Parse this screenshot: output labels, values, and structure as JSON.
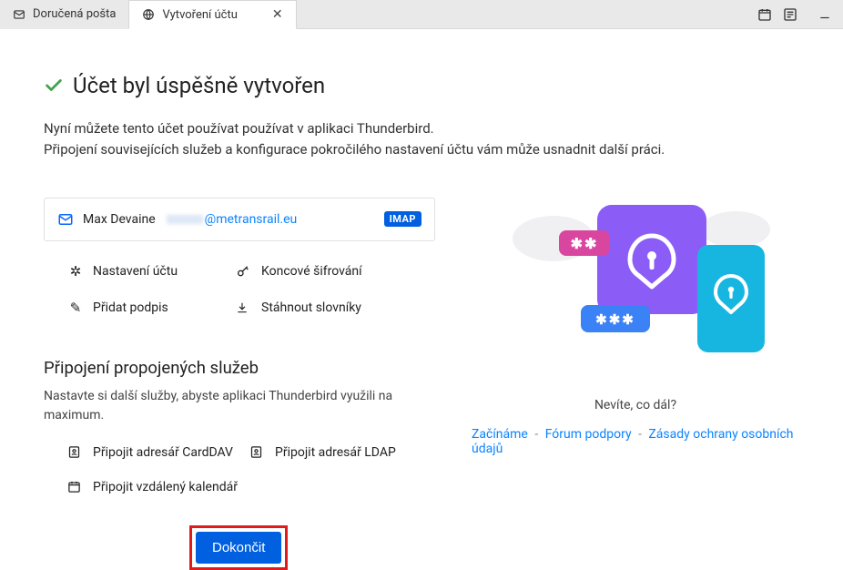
{
  "tabs": {
    "inbox_label": "Doručená pošta",
    "create_label": "Vytvoření účtu"
  },
  "page": {
    "title": "Účet byl úspěšně vytvořen",
    "para1": "Nyní můžete tento účet používat používat v aplikaci Thunderbird.",
    "para2": "Připojení souvisejících služeb a konfigurace pokročilého nastavení účtu vám může usnadnit další práci."
  },
  "account": {
    "name": "Max Devaine",
    "email_domain": "@metransrail.eu",
    "badge": "IMAP"
  },
  "options": {
    "settings": "Nastavení účtu",
    "e2e": "Koncové šifrování",
    "signature": "Přidat podpis",
    "dictionaries": "Stáhnout slovníky"
  },
  "linked": {
    "title": "Připojení propojených služeb",
    "subtitle": "Nastavte si další služby, abyste aplikaci Thunderbird využili na maximum.",
    "carddav": "Připojit adresář CardDAV",
    "ldap": "Připojit adresář LDAP",
    "calendar": "Připojit vzdálený kalendář"
  },
  "finish_button": "Dokončit",
  "help": {
    "question": "Nevíte, co dál?",
    "getting_started": "Začínáme",
    "support_forum": "Fórum podpory",
    "privacy": "Zásady ochrany osobních údajů"
  }
}
